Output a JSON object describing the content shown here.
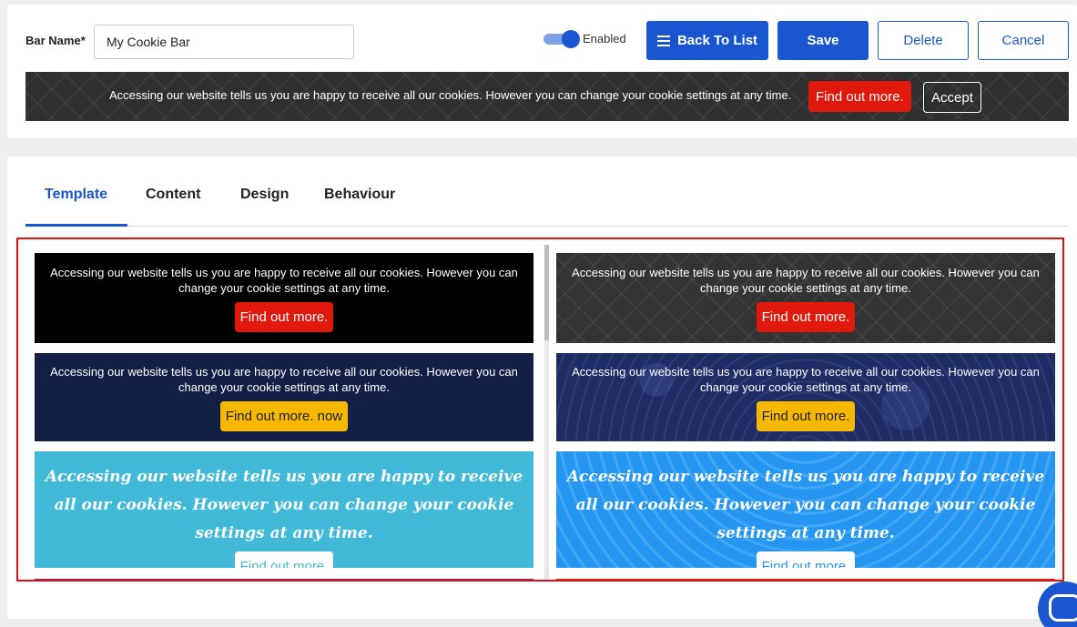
{
  "form": {
    "bar_name_label": "Bar Name*",
    "bar_name_value": "My Cookie Bar",
    "toggle_label": "Enabled",
    "toggle_on": true
  },
  "buttons": {
    "back": "Back To List",
    "save": "Save",
    "delete": "Delete",
    "cancel": "Cancel"
  },
  "preview": {
    "text": "Accessing our website tells us you are happy to receive all our cookies. However you can change your cookie settings at any time.",
    "find_out": "Find out more.",
    "accept": "Accept"
  },
  "tabs": [
    {
      "label": "Template",
      "active": true
    },
    {
      "label": "Content"
    },
    {
      "label": "Design"
    },
    {
      "label": "Behaviour"
    }
  ],
  "templates": [
    {
      "text": "Accessing our website tells us you are happy to receive all our cookies. However you can change your cookie settings at any time.",
      "button": "Find out more.",
      "button_color": "#e1190d",
      "bg": "#000000"
    },
    {
      "text": "Accessing our website tells us you are happy to receive all our cookies. However you can change your cookie settings at any time.",
      "button": "Find out more.",
      "button_color": "#e1190d",
      "bg": "#333333"
    },
    {
      "text": "Accessing our website tells us you are happy to receive all our cookies. However you can change your cookie settings at any time.",
      "button": "Find out more. now",
      "button_color": "#f6b800",
      "bg": "#141f45"
    },
    {
      "text": "Accessing our website tells us you are happy to receive all our cookies. However you can change your cookie settings at any time.",
      "button": "Find out more.",
      "button_color": "#f6b800",
      "bg": "#1e2b64"
    },
    {
      "text": "Accessing our website tells us you are happy to receive all our cookies. However you can change your cookie settings at any time.",
      "button": "Find out more.",
      "button_color": "#ffffff",
      "bg": "#41b9d9"
    },
    {
      "text": "Accessing our website tells us you are happy to receive all our cookies. However you can change your cookie settings at any time.",
      "button": "Find out more.",
      "button_color": "#ffffff",
      "bg": "#2495f0"
    }
  ],
  "colors": {
    "primary": "#1a56cf",
    "selection_border": "#e01010"
  }
}
